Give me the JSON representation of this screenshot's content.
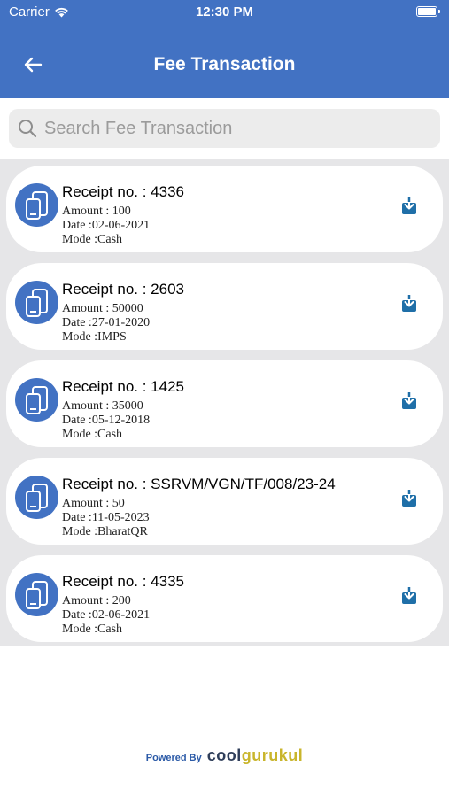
{
  "status_bar": {
    "carrier": "Carrier",
    "time": "12:30 PM"
  },
  "header": {
    "title": "Fee Transaction",
    "back_icon": "arrow-left-icon"
  },
  "search": {
    "placeholder": "Search Fee Transaction",
    "value": ""
  },
  "transactions": [
    {
      "receipt": "Receipt no. : 4336",
      "amount": "Amount : 100",
      "date": "Date :02-06-2021",
      "mode": "Mode :Cash"
    },
    {
      "receipt": "Receipt no. : 2603",
      "amount": "Amount : 50000",
      "date": "Date :27-01-2020",
      "mode": "Mode :IMPS"
    },
    {
      "receipt": "Receipt no. : 1425",
      "amount": "Amount : 35000",
      "date": "Date :05-12-2018",
      "mode": "Mode :Cash"
    },
    {
      "receipt": "Receipt no. : SSRVM/VGN/TF/008/23-24",
      "amount": "Amount : 50",
      "date": "Date :11-05-2023",
      "mode": "Mode :BharatQR"
    },
    {
      "receipt": "Receipt no. : 4335",
      "amount": "Amount : 200",
      "date": "Date :02-06-2021",
      "mode": "Mode :Cash"
    }
  ],
  "footer": {
    "powered_by": "Powered By",
    "brand_part1": "cool",
    "brand_part2": "gurukul"
  },
  "colors": {
    "header": "#4272c3",
    "download": "#1f6fa8",
    "list_bg": "#e6e6e8",
    "brand_gold": "#c9b52c"
  }
}
